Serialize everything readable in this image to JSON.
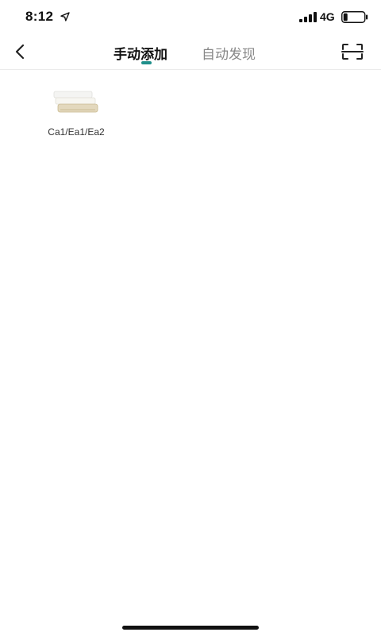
{
  "status_bar": {
    "time": "8:12",
    "network": "4G",
    "icons": [
      "location-arrow-icon",
      "signal-bars-icon",
      "battery-icon"
    ],
    "battery_level": 0.2
  },
  "header": {
    "back_icon": "chevron-left-icon",
    "tabs": [
      {
        "label": "手动添加",
        "active": true
      },
      {
        "label": "自动发现",
        "active": false
      }
    ],
    "scan_icon": "scan-frame-icon",
    "indicator_color": "#1f8f8a"
  },
  "devices": [
    {
      "label": "Ca1/Ea1/Ea2",
      "icon": "air-conditioner-unit-icon"
    }
  ]
}
